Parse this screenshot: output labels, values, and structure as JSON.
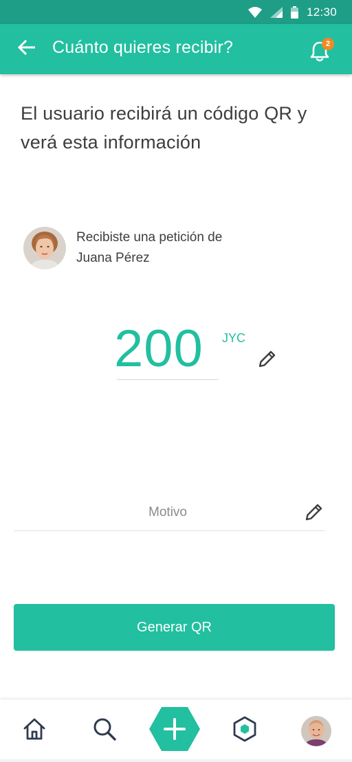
{
  "status_bar": {
    "time": "12:30",
    "icons": [
      "wifi-icon",
      "signal-icon",
      "battery-icon"
    ]
  },
  "app_bar": {
    "title": "Cuánto quieres recibir?",
    "back_icon": "arrow-left-icon",
    "notifications_icon": "bell-icon",
    "notification_count": "2"
  },
  "heading": "El usuario recibirá un código QR y verá esta información",
  "request": {
    "line1": "Recibiste una petición de",
    "name": "Juana Pérez",
    "avatar_icon": "user-avatar"
  },
  "amount": {
    "value": "200",
    "currency": "JYC",
    "edit_icon": "pencil-icon"
  },
  "motivo": {
    "placeholder": "Motivo",
    "edit_icon": "pencil-icon"
  },
  "primary_button": "Generar QR",
  "bottom_nav": {
    "items": [
      "home-icon",
      "search-icon",
      "add-icon",
      "exchange-icon",
      "profile-avatar"
    ]
  },
  "colors": {
    "primary": "#22bfa0",
    "status_bar": "#1e9e86",
    "badge": "#f08a24",
    "text": "#3d3d3d",
    "nav_icon": "#2f3a4f"
  }
}
